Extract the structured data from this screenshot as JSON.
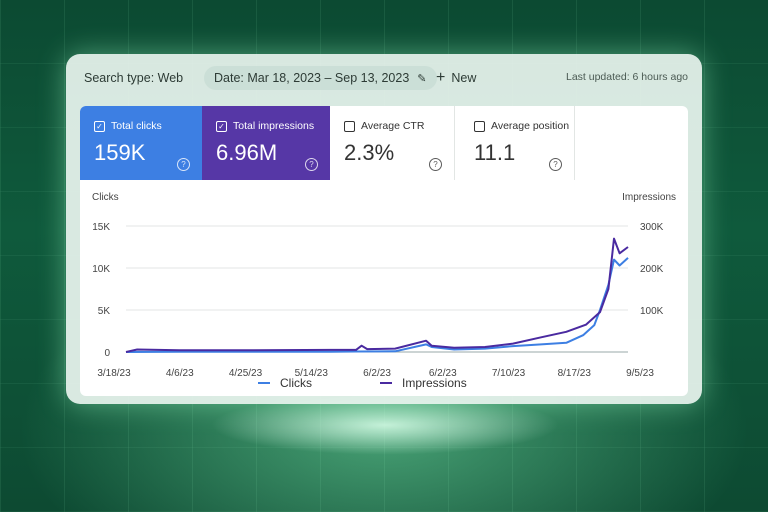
{
  "toolbar": {
    "search_type": "Search type: Web",
    "date_range": "Date: Mar 18, 2023 – Sep 13, 2023",
    "new_label": "New",
    "last_updated": "Last updated: 6 hours ago"
  },
  "metrics": [
    {
      "label": "Total clicks",
      "value": "159K",
      "checked": true,
      "color": "#3d7fe3"
    },
    {
      "label": "Total impressions",
      "value": "6.96M",
      "checked": true,
      "color": "#5637a6"
    },
    {
      "label": "Average CTR",
      "value": "2.3%",
      "checked": false
    },
    {
      "label": "Average position",
      "value": "11.1",
      "checked": false
    }
  ],
  "chart_data": {
    "type": "line",
    "ylabel_left": "Clicks",
    "ylabel_right": "Impressions",
    "y_left_ticks": [
      "15K",
      "10K",
      "5K",
      "0"
    ],
    "y_left_range": [
      0,
      15000
    ],
    "y_right_ticks": [
      "300K",
      "200K",
      "100K"
    ],
    "y_right_range": [
      0,
      300000
    ],
    "x_tick_labels": [
      "3/18/23",
      "4/6/23",
      "4/25/23",
      "5/14/23",
      "6/2/23",
      "6/2/23",
      "7/10/23",
      "8/17/23",
      "9/5/23"
    ],
    "x_range": [
      "2023-03-18",
      "2023-09-13"
    ],
    "grid": true,
    "legend_position": "bottom",
    "series": [
      {
        "name": "Clicks",
        "axis": "left",
        "color": "#3d7fe3",
        "points": [
          [
            "2023-03-18",
            0
          ],
          [
            "2023-04-06",
            20
          ],
          [
            "2023-05-01",
            30
          ],
          [
            "2023-05-30",
            40
          ],
          [
            "2023-06-08",
            60
          ],
          [
            "2023-06-22",
            80
          ],
          [
            "2023-07-03",
            900
          ],
          [
            "2023-07-05",
            600
          ],
          [
            "2023-07-13",
            300
          ],
          [
            "2023-07-24",
            400
          ],
          [
            "2023-08-03",
            700
          ],
          [
            "2023-08-13",
            900
          ],
          [
            "2023-08-22",
            1100
          ],
          [
            "2023-08-28",
            2000
          ],
          [
            "2023-09-01",
            3200
          ],
          [
            "2023-09-03",
            5000
          ],
          [
            "2023-09-06",
            8000
          ],
          [
            "2023-09-08",
            11000
          ],
          [
            "2023-09-10",
            10300
          ],
          [
            "2023-09-13",
            11200
          ]
        ]
      },
      {
        "name": "Impressions",
        "axis": "right",
        "color": "#4a2aa0",
        "points": [
          [
            "2023-03-18",
            0
          ],
          [
            "2023-03-22",
            6000
          ],
          [
            "2023-04-06",
            4000
          ],
          [
            "2023-05-01",
            4000
          ],
          [
            "2023-05-30",
            5000
          ],
          [
            "2023-06-08",
            5000
          ],
          [
            "2023-06-10",
            15000
          ],
          [
            "2023-06-12",
            7000
          ],
          [
            "2023-06-22",
            8000
          ],
          [
            "2023-07-03",
            27000
          ],
          [
            "2023-07-05",
            15000
          ],
          [
            "2023-07-13",
            10000
          ],
          [
            "2023-07-24",
            12000
          ],
          [
            "2023-08-03",
            20000
          ],
          [
            "2023-08-13",
            35000
          ],
          [
            "2023-08-22",
            48000
          ],
          [
            "2023-08-29",
            65000
          ],
          [
            "2023-09-03",
            95000
          ],
          [
            "2023-09-06",
            150000
          ],
          [
            "2023-09-08",
            270000
          ],
          [
            "2023-09-10",
            235000
          ],
          [
            "2023-09-13",
            250000
          ]
        ]
      }
    ]
  }
}
